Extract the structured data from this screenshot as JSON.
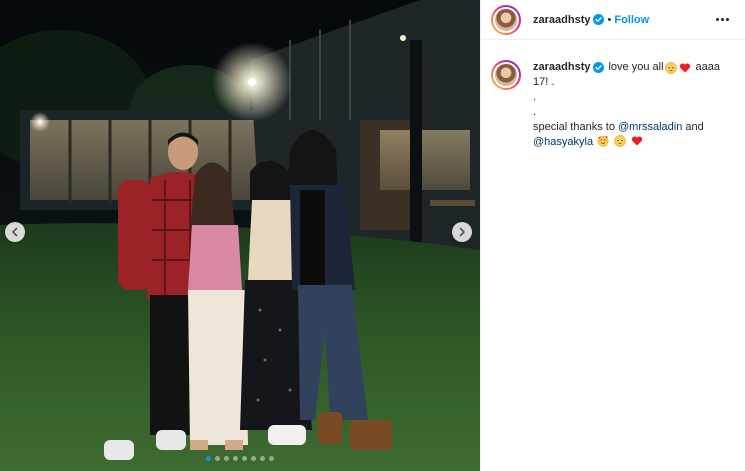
{
  "post": {
    "username": "zaraadhsty",
    "separator": "•",
    "follow_label": "Follow",
    "caption": {
      "username": "zaraadhsty",
      "text_start": "love you all",
      "text_after_emojis": "aaaa",
      "line2": "17! .",
      "line3": ".",
      "line4": ".",
      "thanks_prefix": "special thanks to",
      "mention1": "@mrssaladin",
      "and_word": "and",
      "mention2": "@hasyakyla"
    },
    "carousel": {
      "slide_count": 8,
      "active_index": 0
    }
  },
  "colors": {
    "accent": "#0095f6",
    "mention": "#00376b",
    "heart": "#ed1c24",
    "emoji_face": "#ffcc4d"
  },
  "icons": [
    "chevron-left-icon",
    "chevron-right-icon",
    "verified-badge-icon",
    "more-options-icon",
    "pleading-face-emoji",
    "red-heart-emoji",
    "smiling-hearts-emoji"
  ]
}
